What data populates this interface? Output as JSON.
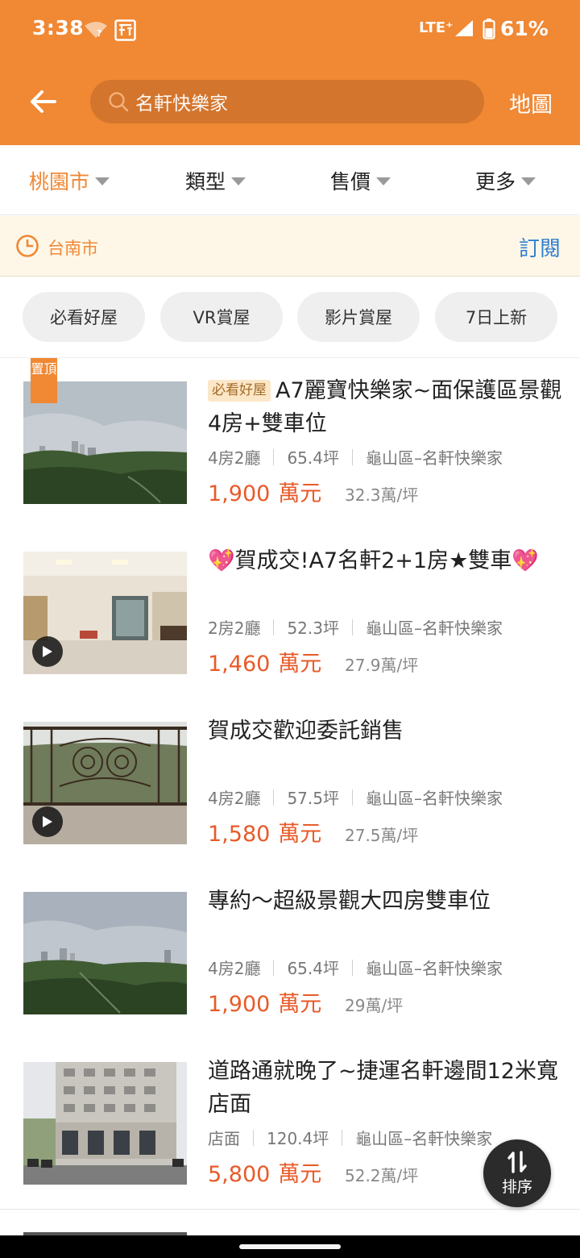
{
  "status_bar": {
    "time": "3:38",
    "network": "LTE⁺",
    "battery": "61%"
  },
  "header": {
    "search_value": "名軒快樂家",
    "map_label": "地圖"
  },
  "filters": [
    {
      "label": "桃園市",
      "active": true
    },
    {
      "label": "類型",
      "active": false
    },
    {
      "label": "售價",
      "active": false
    },
    {
      "label": "更多",
      "active": false
    }
  ],
  "location_bar": {
    "location": "台南市",
    "subscribe_label": "訂閱"
  },
  "chips": [
    "必看好屋",
    "VR賞屋",
    "影片賞屋",
    "7日上新"
  ],
  "listings": [
    {
      "badge": "必看好屋",
      "title": "A7麗寶快樂家~面保護區景觀4房+雙車位",
      "pinned_label": "置頂",
      "layout": "4房2廳",
      "size": "65.4坪",
      "location": "龜山區–名軒快樂家",
      "price": "1,900",
      "price_unit": "萬元",
      "price_per_ping": "32.3萬/坪",
      "has_video": false
    },
    {
      "title": "💖賀成交!A7名軒2+1房★雙車💖",
      "layout": "2房2廳",
      "size": "52.3坪",
      "location": "龜山區–名軒快樂家",
      "price": "1,460",
      "price_unit": "萬元",
      "price_per_ping": "27.9萬/坪",
      "has_video": true
    },
    {
      "title": "賀成交歡迎委託銷售",
      "layout": "4房2廳",
      "size": "57.5坪",
      "location": "龜山區–名軒快樂家",
      "price": "1,580",
      "price_unit": "萬元",
      "price_per_ping": "27.5萬/坪",
      "has_video": true
    },
    {
      "title": "專約～超級景觀大四房雙車位",
      "layout": "4房2廳",
      "size": "65.4坪",
      "location": "龜山區–名軒快樂家",
      "price": "1,900",
      "price_unit": "萬元",
      "price_per_ping": "29萬/坪",
      "has_video": false
    },
    {
      "title": "道路通就晚了~捷運名軒邊間12米寬店面",
      "layout": "店面",
      "size": "120.4坪",
      "location": "龜山區–名軒快樂家",
      "price": "5,800",
      "price_unit": "萬元",
      "price_per_ping": "52.2萬/坪",
      "has_video": false
    }
  ],
  "sort_fab": {
    "label": "排序"
  },
  "icons": {
    "back": "back-arrow-icon",
    "search": "search-icon",
    "clock": "clock-icon",
    "play": "play-icon",
    "sort": "sort-icon"
  },
  "colors": {
    "accent": "#f08834",
    "price": "#e85a28",
    "link": "#2f7fd0"
  }
}
